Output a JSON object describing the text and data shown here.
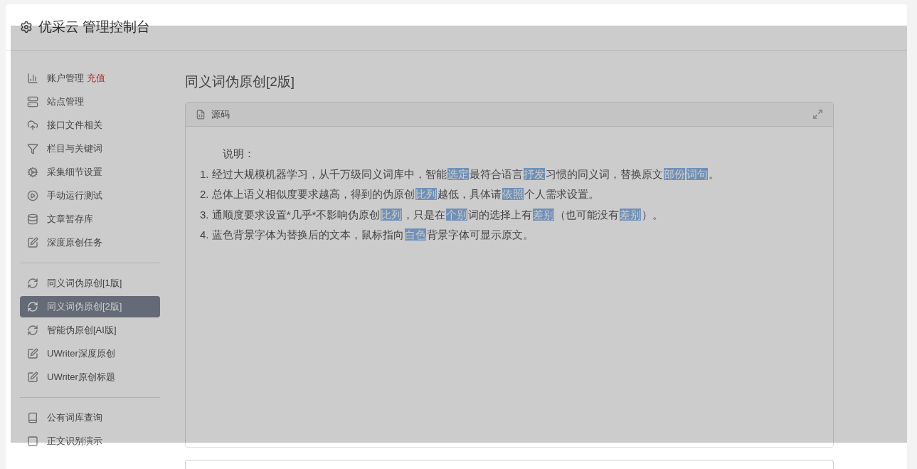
{
  "header": {
    "title": "优采云 管理控制台"
  },
  "sidebar": {
    "groups": [
      {
        "items": [
          {
            "label": "账户管理",
            "badge": "充值",
            "kind": "chart",
            "selected": false
          },
          {
            "label": "站点管理",
            "kind": "server",
            "selected": false
          },
          {
            "label": "接口文件相关",
            "kind": "cloud",
            "selected": false
          },
          {
            "label": "栏目与关键词",
            "kind": "filter",
            "selected": false
          },
          {
            "label": "采集细节设置",
            "kind": "gears",
            "selected": false
          },
          {
            "label": "手动运行测试",
            "kind": "play",
            "selected": false
          },
          {
            "label": "文章暂存库",
            "kind": "database",
            "selected": false
          },
          {
            "label": "深度原创任务",
            "kind": "edit",
            "selected": false
          }
        ]
      },
      {
        "items": [
          {
            "label": "同义词伪原创[1版]",
            "kind": "refresh",
            "selected": false
          },
          {
            "label": "同义词伪原创[2版]",
            "kind": "refresh",
            "selected": true
          },
          {
            "label": "智能伪原创[AI版]",
            "kind": "refresh",
            "selected": false
          },
          {
            "label": "UWriter深度原创",
            "kind": "edit",
            "selected": false
          },
          {
            "label": "UWriter原创标题",
            "kind": "edit",
            "selected": false
          }
        ]
      },
      {
        "items": [
          {
            "label": "公有词库查询",
            "kind": "book",
            "selected": false
          },
          {
            "label": "正文识别演示",
            "kind": "square",
            "selected": false
          }
        ]
      }
    ]
  },
  "main": {
    "heading": "同义词伪原创[2版]",
    "panel": {
      "title": "源码",
      "intro": "说明：",
      "lines": [
        [
          {
            "t": "1. 经过大规模机器学习，从千万级同义词库中，智能",
            "hl": false
          },
          {
            "t": "选定",
            "hl": true
          },
          {
            "t": "最符合语言",
            "hl": false
          },
          {
            "t": "抒发",
            "hl": true
          },
          {
            "t": "习惯的同义词，替换原文",
            "hl": false
          },
          {
            "t": "部份",
            "hl": true
          },
          {
            "t": "词句",
            "hl": true
          },
          {
            "t": "。",
            "hl": false
          }
        ],
        [
          {
            "t": "2. 总体上语义相似度要求越高，得到的伪原创",
            "hl": false
          },
          {
            "t": "比列",
            "hl": true
          },
          {
            "t": "越低，具体请",
            "hl": false
          },
          {
            "t": "依照",
            "hl": true
          },
          {
            "t": "个人需求设置。",
            "hl": false
          }
        ],
        [
          {
            "t": "3. 通顺度要求设置*几乎*不影响伪原创",
            "hl": false
          },
          {
            "t": "比列",
            "hl": true
          },
          {
            "t": "，只是在",
            "hl": false
          },
          {
            "t": "个别",
            "hl": true
          },
          {
            "t": "词的选择上有",
            "hl": false
          },
          {
            "t": "差别",
            "hl": true
          },
          {
            "t": "（也可能没有",
            "hl": false
          },
          {
            "t": "差别",
            "hl": true
          },
          {
            "t": "）。",
            "hl": false
          }
        ],
        [
          {
            "t": "4. 蓝色背景字体为替换后的文本，鼠标指向",
            "hl": false
          },
          {
            "t": "白色",
            "hl": true
          },
          {
            "t": "背景字体可显示原文。",
            "hl": false
          }
        ]
      ]
    }
  },
  "overlay": {
    "shown": true
  }
}
